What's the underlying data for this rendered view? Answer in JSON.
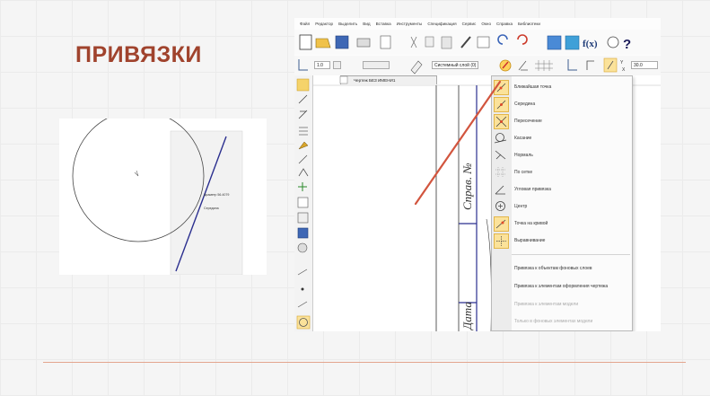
{
  "slide": {
    "title": "ПРИВЯЗКИ",
    "title_color": "#a0432d",
    "line_color": "#e3a58e"
  },
  "left_screenshot": {
    "tooltip_line1": "Диаметр 56.4079",
    "tooltip_line2": "Середина",
    "line_color": "#2b2f8f"
  },
  "app": {
    "menu": [
      "Файл",
      "Редактор",
      "Выделить",
      "Вид",
      "Вставка",
      "Инструменты",
      "Спецификация",
      "Сервис",
      "Окно",
      "Справка",
      "Библиотеки"
    ],
    "style_combo": "1.0",
    "layer_combo": "Системный слой (0)",
    "coord_value": "30.0",
    "doc_tab": "Чертеж БЕЗ ИМЕНИ1",
    "drawing_text_1": "Справ. №",
    "drawing_text_2": "Дата"
  },
  "snap_menu": {
    "items": [
      {
        "label": "Ближайшая точка",
        "checked": true
      },
      {
        "label": "Середина",
        "checked": true
      },
      {
        "label": "Пересечение",
        "checked": true
      },
      {
        "label": "Касание",
        "checked": false
      },
      {
        "label": "Нормаль",
        "checked": false
      },
      {
        "label": "По сетке",
        "checked": false
      },
      {
        "label": "Угловая привязка",
        "checked": false
      },
      {
        "label": "Центр",
        "checked": false
      },
      {
        "label": "Точка на кривой",
        "checked": true
      },
      {
        "label": "Выравнивание",
        "checked": true
      }
    ],
    "extra": [
      {
        "label": "Привязка к объектам фоновых слоев",
        "disabled": false
      },
      {
        "label": "Привязка к элементам оформления чертежа",
        "disabled": false
      },
      {
        "label": "Привязка к элементам модели",
        "disabled": true
      },
      {
        "label": "Только в фоновых элементах модели",
        "disabled": true
      }
    ]
  },
  "arrow_color": "#d2553e"
}
